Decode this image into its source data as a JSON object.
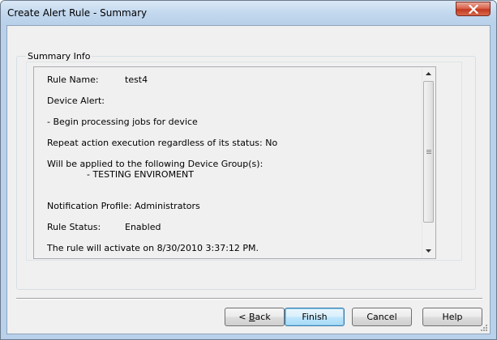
{
  "window": {
    "title": "Create Alert Rule - Summary"
  },
  "summary": {
    "group_label": "Summary Info",
    "rule_name_label": "Rule Name:",
    "rule_name_value": "test4",
    "device_alert_label": "Device Alert:",
    "alert_action": "- Begin processing jobs for device",
    "repeat_action": "Repeat action execution regardless of its status: No",
    "applied_to_label": "Will be applied to the following Device Group(s):",
    "device_group": "- TESTING ENVIROMENT",
    "notification_profile": "Notification Profile: Administrators",
    "rule_status_label": "Rule Status:",
    "rule_status_value": "Enabled",
    "activation": "The rule will activate on 8/30/2010 3:37:12 PM."
  },
  "buttons": {
    "back_prefix": "< ",
    "back_mnemonic": "B",
    "back_rest": "ack",
    "finish": "Finish",
    "cancel": "Cancel",
    "help": "Help"
  },
  "icons": {
    "close": "close-icon",
    "scroll_up": "scroll-up-arrow-icon",
    "scroll_down": "scroll-down-arrow-icon",
    "resize": "resize-grip-icon"
  }
}
